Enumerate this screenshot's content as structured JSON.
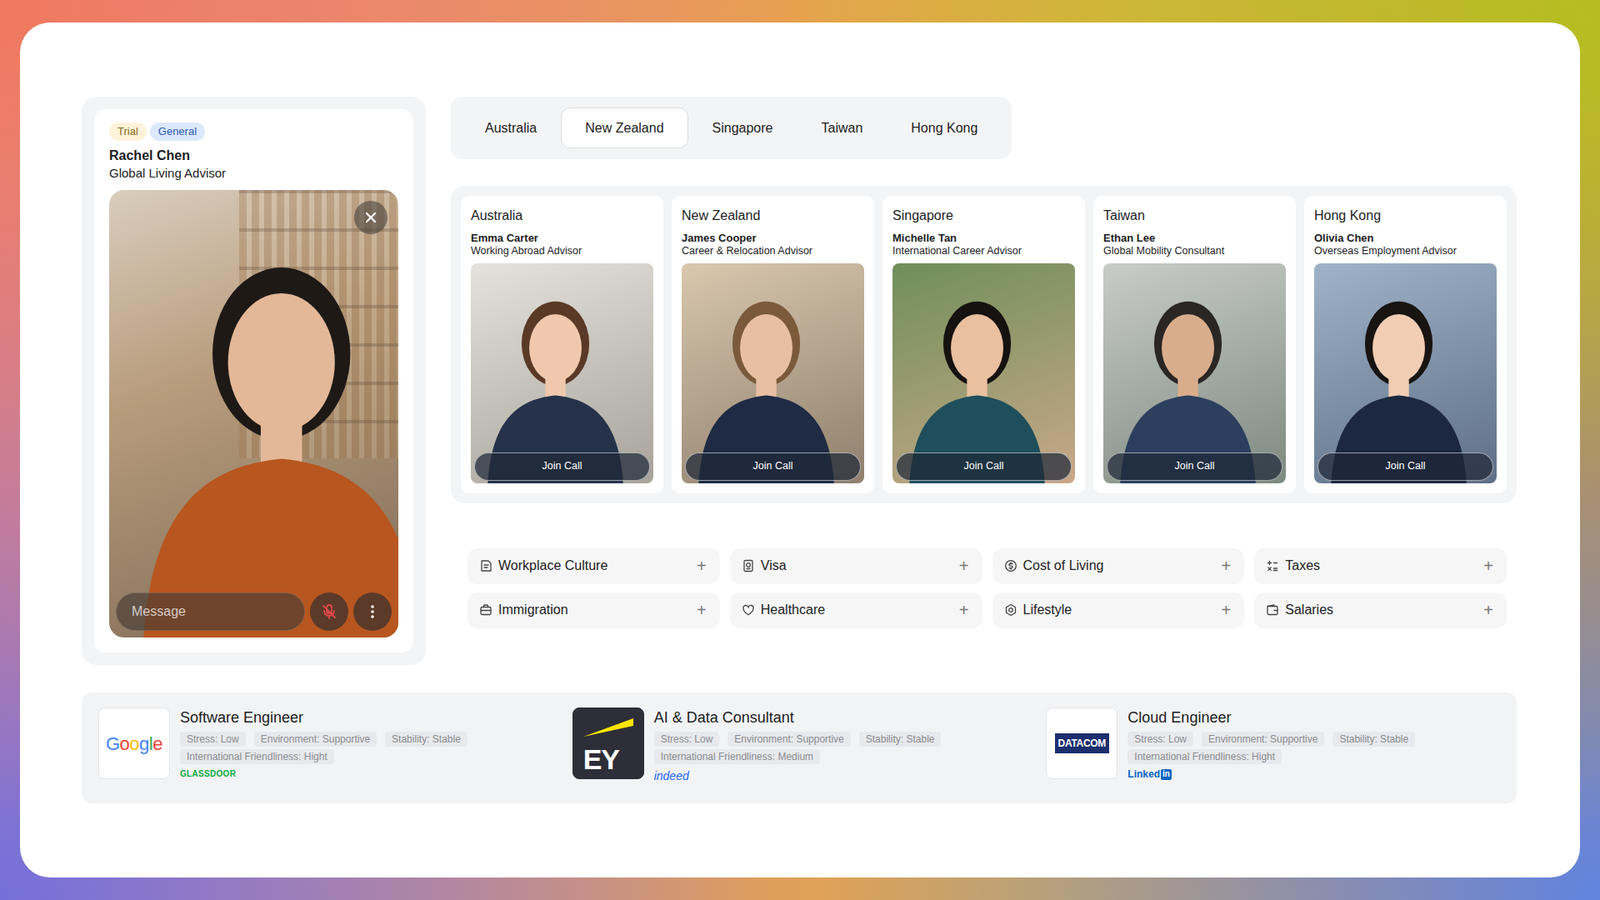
{
  "advisor_panel": {
    "badges": [
      {
        "label": "Trial",
        "color": "#fdf3d8"
      },
      {
        "label": "General",
        "color": "#dce8fb"
      }
    ],
    "name": "Rachel Chen",
    "role": "Global Living Advisor",
    "message_placeholder": "Message",
    "mic_muted": true
  },
  "tabs": [
    {
      "label": "Australia",
      "selected": false
    },
    {
      "label": "New Zealand",
      "selected": true
    },
    {
      "label": "Singapore",
      "selected": false
    },
    {
      "label": "Taiwan",
      "selected": false
    },
    {
      "label": "Hong Kong",
      "selected": false
    }
  ],
  "advisors": [
    {
      "country": "Australia",
      "name": "Emma Carter",
      "role": "Working Abroad Advisor",
      "button": "Join Call"
    },
    {
      "country": "New Zealand",
      "name": "James Cooper",
      "role": "Career & Relocation Advisor",
      "button": "Join Call"
    },
    {
      "country": "Singapore",
      "name": "Michelle Tan",
      "role": "International Career Advisor",
      "button": "Join Call"
    },
    {
      "country": "Taiwan",
      "name": "Ethan Lee",
      "role": "Global Mobility Consultant",
      "button": "Join Call"
    },
    {
      "country": "Hong Kong",
      "name": "Olivia Chen",
      "role": "Overseas Employment Advisor",
      "button": "Join Call"
    }
  ],
  "topics": [
    {
      "label": "Workplace Culture",
      "toggle": "+",
      "expanded": false
    },
    {
      "label": "Visa",
      "toggle": "+",
      "expanded": false
    },
    {
      "label": "Cost of Living",
      "toggle": "+",
      "expanded": false
    },
    {
      "label": "Taxes",
      "toggle": "+",
      "expanded": false
    },
    {
      "label": "Immigration",
      "toggle": "+",
      "expanded": false
    },
    {
      "label": "Healthcare",
      "toggle": "+",
      "expanded": false
    },
    {
      "label": "Lifestyle",
      "toggle": "+",
      "expanded": false
    },
    {
      "label": "Salaries",
      "toggle": "+",
      "expanded": false
    }
  ],
  "jobs": [
    {
      "kind": "google",
      "logo": "Google",
      "title": "Software Engineer",
      "tags": [
        "Stress: Low",
        "Environment: Supportive",
        "Stability: Stable",
        "International Friendliness: Hight"
      ],
      "source_kind": "glassdoor",
      "source": "GLASSDOOR"
    },
    {
      "kind": "ey",
      "logo": "EY",
      "title": "AI & Data Consultant",
      "tags": [
        "Stress: Low",
        "Environment: Supportive",
        "Stability: Stable",
        "International Friendliness: Medium"
      ],
      "source_kind": "indeed",
      "source": "indeed"
    },
    {
      "kind": "datacom",
      "logo": "DATACOM",
      "title": "Cloud Engineer",
      "tags": [
        "Stress: Low",
        "Environment: Supportive",
        "Stability: Stable",
        "International Friendliness: Hight"
      ],
      "source_kind": "linkedin",
      "source": "Linked",
      "source_badge": "in"
    }
  ]
}
